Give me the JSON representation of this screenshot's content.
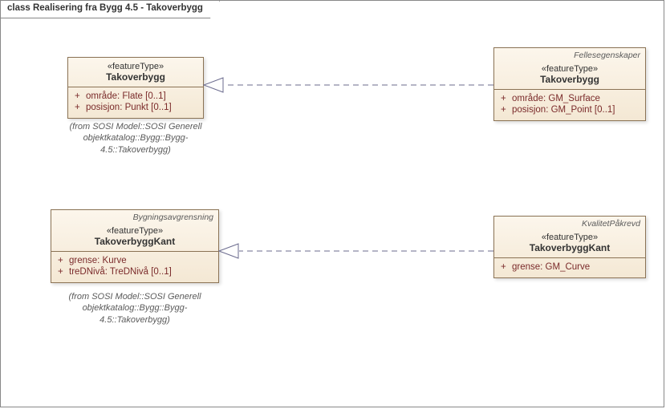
{
  "frame": {
    "title": "class Realisering fra Bygg 4.5 - Takoverbygg"
  },
  "classes": {
    "left1": {
      "stereo": "«featureType»",
      "name": "Takoverbygg",
      "attrs": [
        "område: Flate [0..1]",
        "posisjon: Punkt [0..1]"
      ],
      "caption": "(from SOSI Model::SOSI Generell objektkatalog::Bygg::Bygg-4.5::Takoverbygg)"
    },
    "right1": {
      "top_stereo": "Fellesegenskaper",
      "stereo": "«featureType»",
      "name": "Takoverbygg",
      "attrs": [
        "område: GM_Surface",
        "posisjon: GM_Point [0..1]"
      ]
    },
    "left2": {
      "top_stereo": "Bygningsavgrensning",
      "stereo": "«featureType»",
      "name": "TakoverbyggKant",
      "attrs": [
        "grense: Kurve",
        "treDNivå: TreDNivå [0..1]"
      ],
      "caption": "(from SOSI Model::SOSI Generell objektkatalog::Bygg::Bygg-4.5::Takoverbygg)"
    },
    "right2": {
      "top_stereo": "KvalitetPåkrevd",
      "stereo": "«featureType»",
      "name": "TakoverbyggKant",
      "attrs": [
        "grense: GM_Curve"
      ]
    }
  }
}
